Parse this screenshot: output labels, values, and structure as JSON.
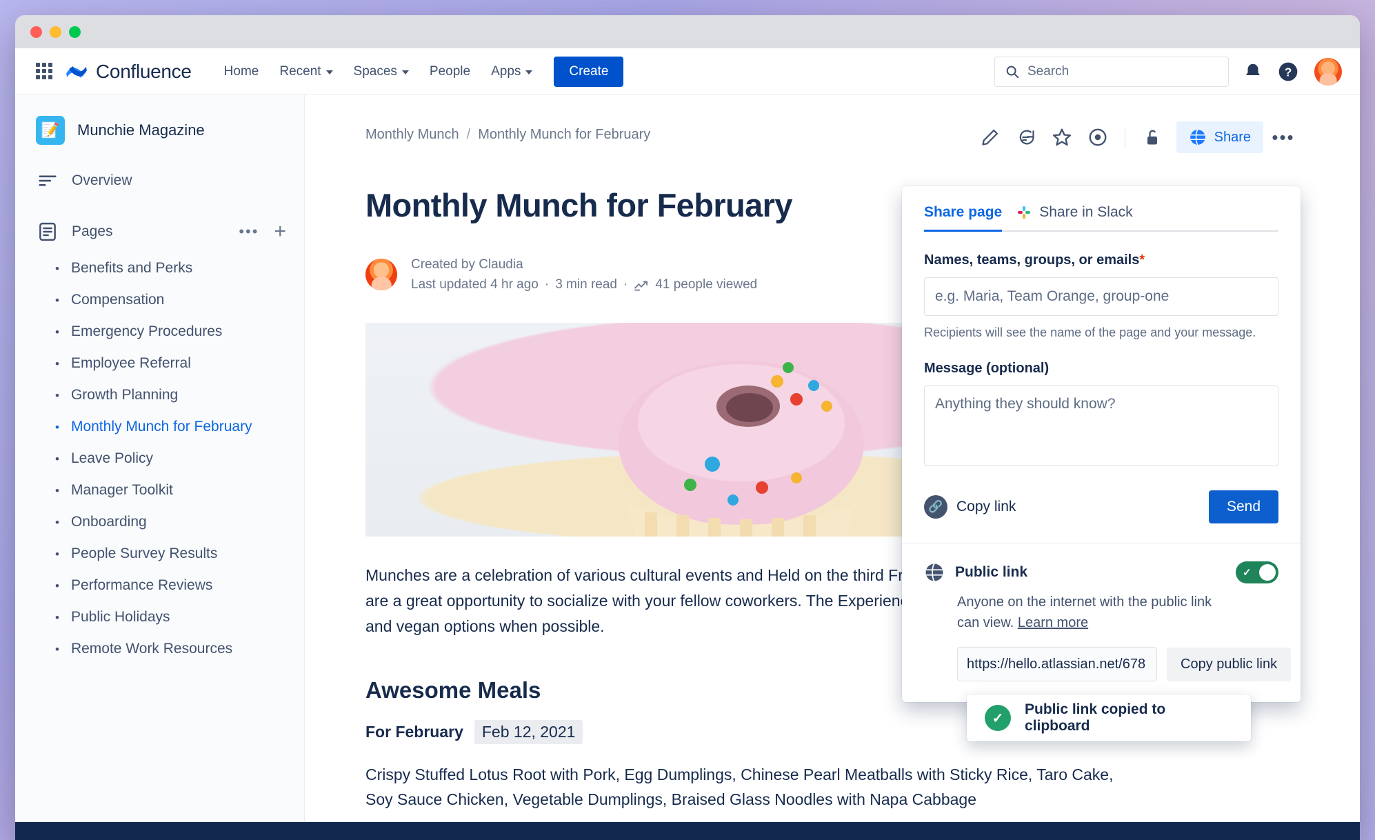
{
  "window": {
    "controls": [
      "close",
      "minimize",
      "maximize"
    ]
  },
  "globalnav": {
    "brand": "Confluence",
    "items": [
      {
        "label": "Home",
        "has_caret": false
      },
      {
        "label": "Recent",
        "has_caret": true
      },
      {
        "label": "Spaces",
        "has_caret": true
      },
      {
        "label": "People",
        "has_caret": false
      },
      {
        "label": "Apps",
        "has_caret": true
      }
    ],
    "create_label": "Create",
    "search_placeholder": "Search",
    "icons": {
      "app_switcher": "grid-icon",
      "notifications": "bell-icon",
      "help": "help-icon",
      "profile": "avatar"
    }
  },
  "sidebar": {
    "space_name": "Munchie Magazine",
    "space_icon": "notebook-pencil-icon",
    "overview_label": "Overview",
    "pages_label": "Pages",
    "pages": [
      "Benefits and Perks",
      "Compensation",
      "Emergency Procedures",
      "Employee Referral",
      "Growth Planning",
      "Monthly Munch for February",
      "Leave Policy",
      "Manager Toolkit",
      "Onboarding",
      "People Survey Results",
      "Performance Reviews",
      "Public Holidays",
      "Remote Work Resources"
    ],
    "active_page": "Monthly Munch for February"
  },
  "content": {
    "breadcrumb": {
      "parent": "Monthly Munch",
      "separator": "/",
      "current": "Monthly Munch for February"
    },
    "tools": [
      "edit-icon",
      "comment-icon",
      "star-icon",
      "watch-eye-icon",
      "unlock-icon",
      "more-icon"
    ],
    "share_label": "Share",
    "title": "Monthly Munch for February",
    "created_by": "Created by Claudia",
    "last_updated": "Last updated 4 hr ago",
    "read_time": "3 min read",
    "views": "41 people viewed",
    "paragraph": "Munches are a celebration of various cultural events and Held on the third Friday of every month, Munches are a great opportunity to socialize with your fellow coworkers. The Experience Team provides vegetarian and vegan options when possible.",
    "section_heading": "Awesome Meals",
    "for_label": "For February",
    "for_date": "Feb 12, 2021",
    "meals": "Crispy Stuffed Lotus Root with Pork, Egg Dumplings, Chinese Pearl Meatballs with Sticky Rice, Taro Cake, Soy Sauce Chicken, Vegetable Dumplings, Braised Glass Noodles with Napa Cabbage"
  },
  "share_dialog": {
    "tab_share_page": "Share page",
    "tab_share_slack": "Share in Slack",
    "recipients_label": "Names, teams, groups, or emails",
    "recipients_required_mark": "*",
    "recipients_placeholder": "e.g. Maria, Team Orange, group-one",
    "recipients_value": "",
    "helper_text": "Recipients will see the name of the page and your message.",
    "message_label": "Message (optional)",
    "message_placeholder": "Anything they should know?",
    "message_value": "",
    "copy_link_label": "Copy link",
    "send_label": "Send",
    "public_link": {
      "title": "Public link",
      "description_line1": "Anyone on the internet with the public link",
      "description_line2": "can view.",
      "learn_more": "Learn more",
      "toggle_on": true,
      "url_value": "https://hello.atlassian.net/678",
      "copy_button": "Copy public link"
    }
  },
  "toast": {
    "message": "Public link copied to clipboard",
    "icon": "success-check-icon"
  },
  "colors": {
    "brand_blue": "#0052cc",
    "link_blue": "#0c66e4",
    "text_dark": "#172b4d",
    "text_subtle": "#6b778c",
    "success_green": "#22a06b",
    "toggle_green": "#1f845a",
    "required_red": "#de350b"
  }
}
